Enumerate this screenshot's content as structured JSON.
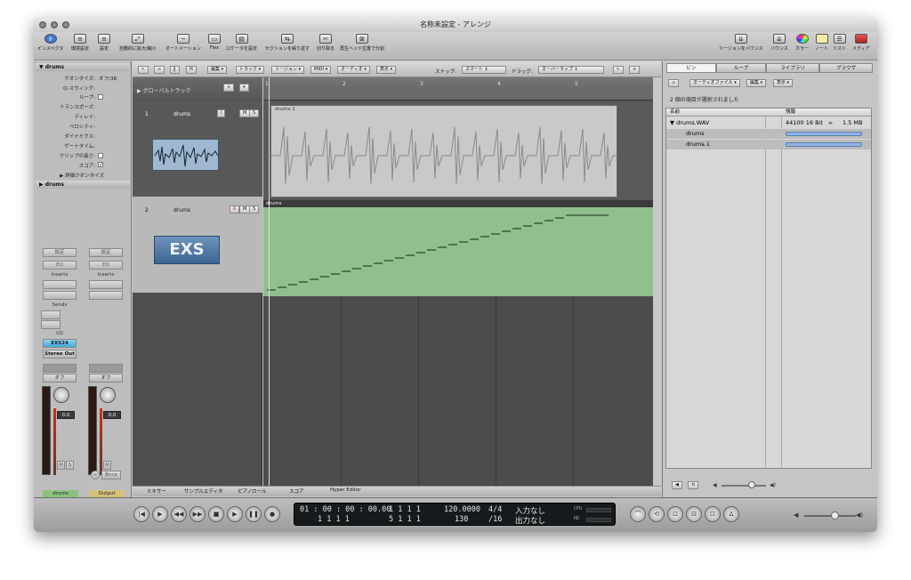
{
  "window": {
    "title": "名称未設定 - アレンジ"
  },
  "toolbar": {
    "left": [
      {
        "label": "インスペクタ",
        "icon": "info-icon"
      },
      {
        "label": "環境設定",
        "icon": "settings-icon"
      },
      {
        "label": "設定",
        "icon": "settings-icon"
      },
      {
        "label": "自動的に拡大/縮小",
        "icon": "zoom-icon"
      },
      {
        "label": "オートメーション",
        "icon": "automation-icon"
      },
      {
        "label": "Flex",
        "icon": "flex-icon"
      },
      {
        "label": "ロケータを設定",
        "icon": "locator-icon"
      },
      {
        "label": "セクションを繰り返す",
        "icon": "repeat-icon"
      },
      {
        "label": "切り取る",
        "icon": "cut-icon"
      },
      {
        "label": "再生ヘッド位置で分割",
        "icon": "split-icon"
      }
    ],
    "right": [
      {
        "label": "リージョンをバウンス",
        "icon": "bounce-region-icon"
      },
      {
        "label": "バウンス",
        "icon": "bounce-icon"
      },
      {
        "label": "カラー",
        "icon": "color-icon"
      },
      {
        "label": "ノート",
        "icon": "notes-icon"
      },
      {
        "label": "リスト",
        "icon": "list-icon"
      },
      {
        "label": "メディア",
        "icon": "media-icon"
      }
    ]
  },
  "inspector": {
    "region_header": "drums",
    "params": [
      {
        "label": "クオンタイズ:",
        "value": "オフ(38"
      },
      {
        "label": "Q-スウィング:",
        "value": ""
      },
      {
        "label": "ループ:",
        "value": "",
        "checkbox": true,
        "checked": false
      },
      {
        "label": "トランスポーズ:",
        "value": ""
      },
      {
        "label": "ディレイ:",
        "value": ""
      },
      {
        "label": "ベロシティ:",
        "value": ""
      },
      {
        "label": "ダイナミクス:",
        "value": ""
      },
      {
        "label": "ゲートタイム:",
        "value": ""
      },
      {
        "label": "クリップの長さ:",
        "value": "",
        "checkbox": true,
        "checked": false
      },
      {
        "label": "スコア:",
        "value": "",
        "checkbox": true,
        "checked": true
      }
    ],
    "advanced_quantize": "▶ 詳細クオンタイズ",
    "track_header": "drums",
    "strips": {
      "setting": "設定",
      "eq": "EQ",
      "inserts": "Inserts",
      "sends": "Sends",
      "io": "I/O",
      "instrument": "EXS24",
      "output": "Stereo Out",
      "off": "オフ",
      "volume": "0.0",
      "mute": "M",
      "solo": "S",
      "bnce": "Bnce",
      "left_name": "drums",
      "right_name": "Output"
    }
  },
  "arrange_toolbar": {
    "menus": [
      "編集",
      "トラック",
      "リージョン",
      "MIDI",
      "オーディオ",
      "表示"
    ],
    "snap_label": "スナップ:",
    "snap_value": "スマート",
    "drag_label": "ドラッグ:",
    "drag_value": "オーバーラップ",
    "mini_h": "H"
  },
  "tracks": {
    "global_tracks": "▶ グローバルトラック",
    "list": [
      {
        "number": "1",
        "name": "drums"
      },
      {
        "number": "2",
        "name": "drums"
      }
    ],
    "exs_label": "EXS"
  },
  "ruler": {
    "bars": [
      "1",
      "2",
      "3",
      "4",
      "5"
    ]
  },
  "regions": {
    "audio_name": "drums.1",
    "midi_name": "drums"
  },
  "bottom_tabs": [
    "ミキサー",
    "サンプルエディタ",
    "ピアノロール",
    "スコア",
    "Hyper Editor"
  ],
  "browser": {
    "tabs": [
      "ビン",
      "ループ",
      "ライブラリ",
      "ブラウザ"
    ],
    "menus": [
      "オーディオファイル",
      "編集",
      "表示"
    ],
    "selection_info": "2 個の項目が選択されました",
    "columns": [
      "名前",
      "情報"
    ],
    "file": {
      "name": "▼ drums.WAV",
      "info": "44100  16 Bit",
      "size": "1.5 MB"
    },
    "regions": [
      "drums",
      "drums.1"
    ]
  },
  "transport": {
    "smpte": "01 : 00 : 00 : 00.00",
    "bars_top": "1   1   1   1",
    "bars_bottom": "1   1   1   1",
    "pos2_top": "1   1   1   1",
    "pos2_bottom": "5   1   1   1",
    "tempo": "120.0000",
    "division": "130",
    "sig": "4/4",
    "div2": "/16",
    "in": "入力なし",
    "out": "出力なし",
    "cpu": "CPU",
    "hd": "HD"
  },
  "colors": {
    "accent_midi": "#8fc08e",
    "audio_region": "#c9c9c9",
    "lcd": "#151a1c"
  }
}
